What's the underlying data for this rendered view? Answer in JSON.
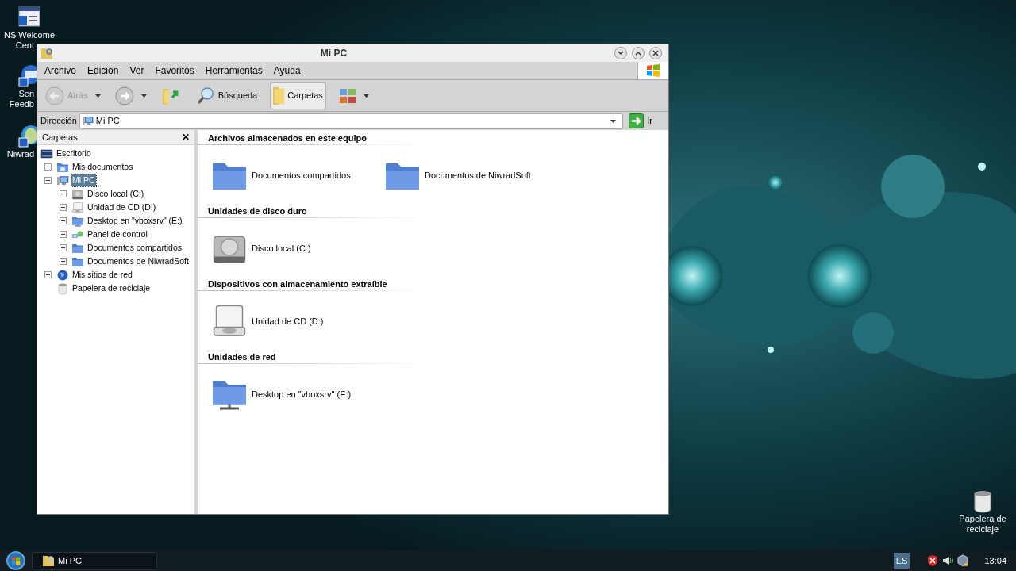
{
  "desktop_icons": [
    {
      "kind": "window",
      "lines": [
        "NS Welcome",
        "Cent"
      ]
    },
    {
      "kind": "feedback",
      "lines": [
        "Sen",
        "Feedb"
      ]
    },
    {
      "kind": "alien",
      "lines": [
        "Niwrad"
      ]
    },
    {
      "kind": "recycle",
      "lines": [
        "Papelera de",
        "reciclaje"
      ]
    }
  ],
  "window": {
    "title": "Mi PC"
  },
  "menu": [
    "Archivo",
    "Edición",
    "Ver",
    "Favoritos",
    "Herramientas",
    "Ayuda"
  ],
  "toolbar": [
    {
      "kind": "back",
      "label": "Atrás",
      "disabled": true,
      "selected": false
    },
    {
      "kind": "forward",
      "disabled": false,
      "selected": false
    },
    {
      "kind": "up",
      "disabled": false,
      "selected": false
    },
    {
      "kind": "search",
      "label": "Búsqueda",
      "disabled": false,
      "selected": false
    },
    {
      "kind": "folders",
      "label": "Carpetas",
      "disabled": false,
      "selected": true
    },
    {
      "kind": "views",
      "disabled": false,
      "selected": false
    }
  ],
  "address": {
    "label": "Dirección",
    "value": "Mi PC",
    "go": "Ir"
  },
  "folders_pane": {
    "title": "Carpetas",
    "close": "✕",
    "tree": [
      {
        "label": "Escritorio",
        "kind": "desktop",
        "selected": false,
        "children": [
          {
            "label": "Mis documentos",
            "kind": "documents",
            "expanded": false,
            "selected": false
          },
          {
            "label": "Mi PC",
            "kind": "computer",
            "expanded": true,
            "selected": true,
            "children": [
              {
                "label": "Disco local (C:)",
                "kind": "disk",
                "expanded": false,
                "selected": false
              },
              {
                "label": "Unidad de CD (D:)",
                "kind": "cd",
                "expanded": false,
                "selected": false
              },
              {
                "label": "Desktop en \"vboxsrv\" (E:)",
                "kind": "netdrive",
                "expanded": false,
                "selected": false
              },
              {
                "label": "Panel de control",
                "kind": "control",
                "expanded": false,
                "selected": false
              },
              {
                "label": "Documentos compartidos",
                "kind": "folder",
                "expanded": false,
                "selected": false
              },
              {
                "label": "Documentos de NiwradSoft",
                "kind": "folder",
                "expanded": false,
                "selected": false
              }
            ]
          },
          {
            "label": "Mis sitios de red",
            "kind": "globe",
            "expanded": false,
            "selected": false
          },
          {
            "label": "Papelera de reciclaje",
            "kind": "recycle",
            "selected": false
          }
        ]
      }
    ]
  },
  "groups": [
    {
      "title": "Archivos almacenados en este equipo",
      "items": [
        {
          "label": "Documentos compartidos",
          "kind": "folder"
        },
        {
          "label": "Documentos de NiwradSoft",
          "kind": "folder"
        }
      ]
    },
    {
      "title": "Unidades de disco duro",
      "items": [
        {
          "label": "Disco local (C:)",
          "kind": "disk"
        }
      ]
    },
    {
      "title": "Dispositivos con almacenamiento extraíble",
      "items": [
        {
          "label": "Unidad de CD (D:)",
          "kind": "cd"
        }
      ]
    },
    {
      "title": "Unidades de red",
      "items": [
        {
          "label": "Desktop en \"vboxsrv\" (E:)",
          "kind": "netdrive"
        }
      ]
    }
  ],
  "taskbar": {
    "tasks": [
      {
        "label": "Mi PC",
        "selected": true
      }
    ],
    "language": "ES",
    "clock": "13:04"
  }
}
